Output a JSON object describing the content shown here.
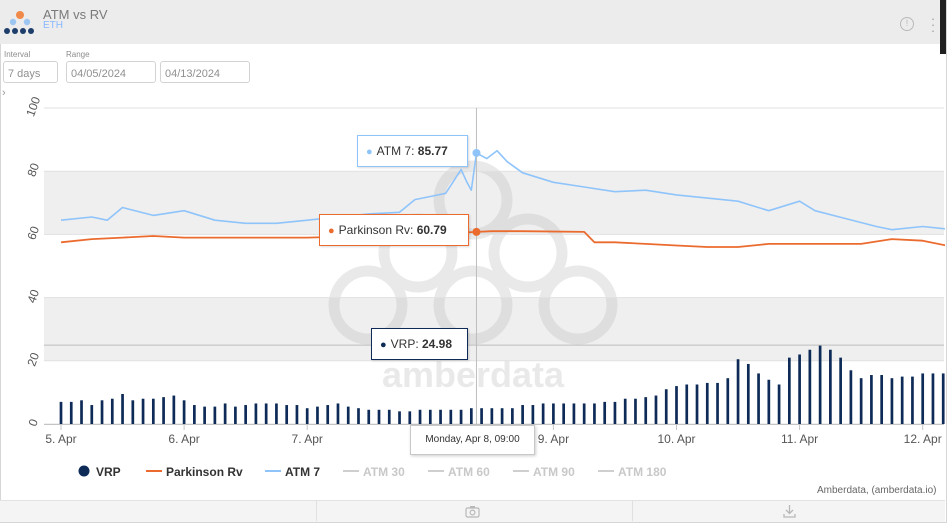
{
  "header": {
    "title": "ATM vs RV",
    "subtitle": "ETH"
  },
  "controls": {
    "interval_label": "Interval",
    "interval_value": "7 days",
    "range_label": "Range",
    "range_start": "04/05/2024",
    "range_end": "04/13/2024"
  },
  "colors": {
    "atm7": "#8fc4fb",
    "parkinson": "#eb6b2f",
    "vrp": "#0e2b57",
    "inactive": "#cfcfcf"
  },
  "icons": {
    "info": "info-icon",
    "menu": "menu-icon",
    "camera": "camera-icon",
    "download": "download-icon",
    "expand": "chevron-right-icon"
  },
  "chart_data": {
    "type": "line",
    "title": "",
    "ylim": [
      0,
      100
    ],
    "y_ticks": [
      "0",
      "20",
      "40",
      "60",
      "80",
      "100"
    ],
    "x_ticks": [
      "5. Apr",
      "6. Apr",
      "7. Apr",
      "8. Apr",
      "9. Apr",
      "10. Apr",
      "11. Apr",
      "12. Apr"
    ],
    "x_start": "2024-04-05T00:00",
    "x_end": "2024-04-12T12:00",
    "grid": true,
    "legend_position": "bottom",
    "legend": [
      "VRP",
      "Parkinson Rv",
      "ATM 7",
      "ATM 30",
      "ATM 60",
      "ATM 90",
      "ATM 180"
    ],
    "series": [
      {
        "name": "ATM 7",
        "type": "line",
        "points": [
          [
            "2024-04-05T00:00",
            64.5
          ],
          [
            "2024-04-05T06:00",
            65.5
          ],
          [
            "2024-04-05T09:00",
            64.5
          ],
          [
            "2024-04-05T12:00",
            68.5
          ],
          [
            "2024-04-05T18:00",
            66
          ],
          [
            "2024-04-06T00:00",
            67.5
          ],
          [
            "2024-04-06T06:00",
            64.5
          ],
          [
            "2024-04-06T12:00",
            63.5
          ],
          [
            "2024-04-06T18:00",
            63.5
          ],
          [
            "2024-04-07T00:00",
            64.5
          ],
          [
            "2024-04-07T06:00",
            65.5
          ],
          [
            "2024-04-07T12:00",
            66.5
          ],
          [
            "2024-04-07T18:00",
            67
          ],
          [
            "2024-04-07T21:00",
            71
          ],
          [
            "2024-04-08T00:00",
            72
          ],
          [
            "2024-04-08T03:00",
            73
          ],
          [
            "2024-04-08T06:00",
            80.5
          ],
          [
            "2024-04-08T07:00",
            77
          ],
          [
            "2024-04-08T08:00",
            74
          ],
          [
            "2024-04-08T09:00",
            85.77
          ],
          [
            "2024-04-08T11:00",
            84
          ],
          [
            "2024-04-08T13:00",
            86.5
          ],
          [
            "2024-04-08T15:00",
            83
          ],
          [
            "2024-04-08T18:00",
            79.5
          ],
          [
            "2024-04-09T00:00",
            76.5
          ],
          [
            "2024-04-09T06:00",
            75
          ],
          [
            "2024-04-09T12:00",
            73.5
          ],
          [
            "2024-04-09T18:00",
            74
          ],
          [
            "2024-04-10T00:00",
            72.5
          ],
          [
            "2024-04-10T06:00",
            71.5
          ],
          [
            "2024-04-10T12:00",
            70.5
          ],
          [
            "2024-04-10T15:00",
            69
          ],
          [
            "2024-04-10T18:00",
            67.5
          ],
          [
            "2024-04-11T00:00",
            70.5
          ],
          [
            "2024-04-11T03:00",
            67.5
          ],
          [
            "2024-04-11T09:00",
            65
          ],
          [
            "2024-04-11T15:00",
            62.5
          ],
          [
            "2024-04-11T18:00",
            61.5
          ],
          [
            "2024-04-12T00:00",
            62.5
          ],
          [
            "2024-04-12T06:00",
            61.5
          ],
          [
            "2024-04-12T12:00",
            61.5
          ]
        ]
      },
      {
        "name": "Parkinson Rv",
        "type": "line",
        "points": [
          [
            "2024-04-05T00:00",
            57.5
          ],
          [
            "2024-04-05T06:00",
            58.5
          ],
          [
            "2024-04-05T12:00",
            59
          ],
          [
            "2024-04-05T18:00",
            59.5
          ],
          [
            "2024-04-06T00:00",
            59
          ],
          [
            "2024-04-06T12:00",
            59
          ],
          [
            "2024-04-07T00:00",
            59
          ],
          [
            "2024-04-07T12:00",
            59.5
          ],
          [
            "2024-04-07T18:00",
            60
          ],
          [
            "2024-04-08T00:00",
            60
          ],
          [
            "2024-04-08T09:00",
            60.79
          ],
          [
            "2024-04-08T12:00",
            61
          ],
          [
            "2024-04-08T18:00",
            61
          ],
          [
            "2024-04-09T06:00",
            60.8
          ],
          [
            "2024-04-09T08:00",
            57.5
          ],
          [
            "2024-04-09T12:00",
            57.5
          ],
          [
            "2024-04-09T18:00",
            57
          ],
          [
            "2024-04-10T00:00",
            56.5
          ],
          [
            "2024-04-10T06:00",
            56
          ],
          [
            "2024-04-10T12:00",
            56
          ],
          [
            "2024-04-10T18:00",
            57
          ],
          [
            "2024-04-11T00:00",
            57
          ],
          [
            "2024-04-11T06:00",
            57
          ],
          [
            "2024-04-11T12:00",
            57
          ],
          [
            "2024-04-11T18:00",
            58.5
          ],
          [
            "2024-04-12T00:00",
            58
          ],
          [
            "2024-04-12T06:00",
            56
          ],
          [
            "2024-04-12T12:00",
            56
          ]
        ]
      },
      {
        "name": "VRP",
        "type": "bar",
        "interval_hours": 2,
        "values": [
          7,
          7,
          7.5,
          6,
          7.5,
          8,
          9.5,
          7.5,
          8,
          8,
          8.5,
          9,
          7.5,
          6,
          5.5,
          5.5,
          6.5,
          5.5,
          6,
          6.5,
          6.5,
          6.5,
          6,
          6,
          5,
          5.5,
          6,
          6.5,
          5.5,
          5,
          4.5,
          4.5,
          4.5,
          4,
          4,
          4.5,
          4.5,
          4.5,
          4.5,
          4.5,
          5,
          5,
          5,
          5,
          5,
          6,
          6,
          6.5,
          6.5,
          6.5,
          6.5,
          6.5,
          6.5,
          7,
          7,
          8,
          8,
          8.5,
          9,
          11,
          12,
          12.5,
          12.5,
          13,
          13,
          14.5,
          20.5,
          19,
          16,
          14,
          12.5,
          21,
          22,
          23.5,
          24.98,
          23.5,
          21,
          17,
          14.5,
          15.5,
          15.5,
          14.5,
          15,
          15,
          16,
          16,
          16,
          16,
          10,
          15.5,
          15.5,
          15.5,
          16,
          16,
          16.5,
          17,
          16.5,
          16,
          16,
          15.5,
          15.5,
          15.5,
          15,
          15,
          14.5,
          14.5,
          14,
          14,
          13,
          13.5,
          14,
          14,
          14,
          14,
          14.5,
          14.5,
          14,
          14,
          13.5,
          14,
          14.5,
          14,
          13,
          11,
          10.5,
          10,
          10.5,
          10.5,
          10.5,
          14.5,
          11.5,
          9.5,
          9.5,
          9,
          7.5,
          7.5,
          7,
          7,
          6,
          5,
          3.5,
          3,
          3,
          3,
          3,
          3.5,
          3.5,
          4,
          4.5,
          4.5,
          4.5,
          4.5,
          5
        ]
      },
      {
        "name": "ATM 30",
        "visible": false
      },
      {
        "name": "ATM 60",
        "visible": false
      },
      {
        "name": "ATM 90",
        "visible": false
      },
      {
        "name": "ATM 180",
        "visible": false
      }
    ],
    "hover": {
      "time_label": "Monday, Apr 8, 09:00",
      "tooltips": [
        {
          "name": "ATM 7",
          "label": "ATM 7: ",
          "value": "85.77"
        },
        {
          "name": "Parkinson Rv",
          "label": "Parkinson Rv: ",
          "value": "60.79"
        },
        {
          "name": "VRP",
          "label": "VRP: ",
          "value": "24.98"
        }
      ]
    },
    "credit": "Amberdata, (amberdata.io)"
  }
}
